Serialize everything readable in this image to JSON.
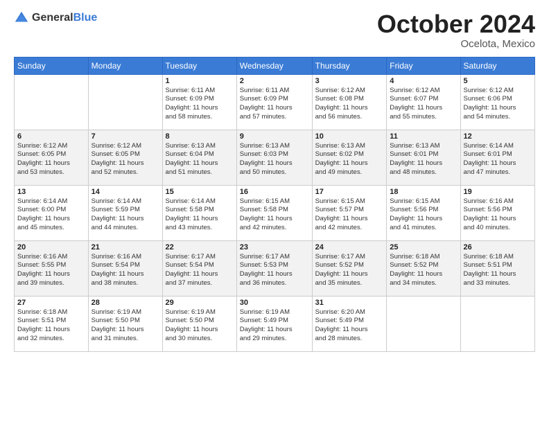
{
  "header": {
    "logo_general": "General",
    "logo_blue": "Blue",
    "title": "October 2024",
    "location": "Ocelota, Mexico"
  },
  "weekdays": [
    "Sunday",
    "Monday",
    "Tuesday",
    "Wednesday",
    "Thursday",
    "Friday",
    "Saturday"
  ],
  "weeks": [
    [
      {
        "day": "",
        "info": ""
      },
      {
        "day": "",
        "info": ""
      },
      {
        "day": "1",
        "info": "Sunrise: 6:11 AM\nSunset: 6:09 PM\nDaylight: 11 hours\nand 58 minutes."
      },
      {
        "day": "2",
        "info": "Sunrise: 6:11 AM\nSunset: 6:09 PM\nDaylight: 11 hours\nand 57 minutes."
      },
      {
        "day": "3",
        "info": "Sunrise: 6:12 AM\nSunset: 6:08 PM\nDaylight: 11 hours\nand 56 minutes."
      },
      {
        "day": "4",
        "info": "Sunrise: 6:12 AM\nSunset: 6:07 PM\nDaylight: 11 hours\nand 55 minutes."
      },
      {
        "day": "5",
        "info": "Sunrise: 6:12 AM\nSunset: 6:06 PM\nDaylight: 11 hours\nand 54 minutes."
      }
    ],
    [
      {
        "day": "6",
        "info": "Sunrise: 6:12 AM\nSunset: 6:05 PM\nDaylight: 11 hours\nand 53 minutes."
      },
      {
        "day": "7",
        "info": "Sunrise: 6:12 AM\nSunset: 6:05 PM\nDaylight: 11 hours\nand 52 minutes."
      },
      {
        "day": "8",
        "info": "Sunrise: 6:13 AM\nSunset: 6:04 PM\nDaylight: 11 hours\nand 51 minutes."
      },
      {
        "day": "9",
        "info": "Sunrise: 6:13 AM\nSunset: 6:03 PM\nDaylight: 11 hours\nand 50 minutes."
      },
      {
        "day": "10",
        "info": "Sunrise: 6:13 AM\nSunset: 6:02 PM\nDaylight: 11 hours\nand 49 minutes."
      },
      {
        "day": "11",
        "info": "Sunrise: 6:13 AM\nSunset: 6:01 PM\nDaylight: 11 hours\nand 48 minutes."
      },
      {
        "day": "12",
        "info": "Sunrise: 6:14 AM\nSunset: 6:01 PM\nDaylight: 11 hours\nand 47 minutes."
      }
    ],
    [
      {
        "day": "13",
        "info": "Sunrise: 6:14 AM\nSunset: 6:00 PM\nDaylight: 11 hours\nand 45 minutes."
      },
      {
        "day": "14",
        "info": "Sunrise: 6:14 AM\nSunset: 5:59 PM\nDaylight: 11 hours\nand 44 minutes."
      },
      {
        "day": "15",
        "info": "Sunrise: 6:14 AM\nSunset: 5:58 PM\nDaylight: 11 hours\nand 43 minutes."
      },
      {
        "day": "16",
        "info": "Sunrise: 6:15 AM\nSunset: 5:58 PM\nDaylight: 11 hours\nand 42 minutes."
      },
      {
        "day": "17",
        "info": "Sunrise: 6:15 AM\nSunset: 5:57 PM\nDaylight: 11 hours\nand 42 minutes."
      },
      {
        "day": "18",
        "info": "Sunrise: 6:15 AM\nSunset: 5:56 PM\nDaylight: 11 hours\nand 41 minutes."
      },
      {
        "day": "19",
        "info": "Sunrise: 6:16 AM\nSunset: 5:56 PM\nDaylight: 11 hours\nand 40 minutes."
      }
    ],
    [
      {
        "day": "20",
        "info": "Sunrise: 6:16 AM\nSunset: 5:55 PM\nDaylight: 11 hours\nand 39 minutes."
      },
      {
        "day": "21",
        "info": "Sunrise: 6:16 AM\nSunset: 5:54 PM\nDaylight: 11 hours\nand 38 minutes."
      },
      {
        "day": "22",
        "info": "Sunrise: 6:17 AM\nSunset: 5:54 PM\nDaylight: 11 hours\nand 37 minutes."
      },
      {
        "day": "23",
        "info": "Sunrise: 6:17 AM\nSunset: 5:53 PM\nDaylight: 11 hours\nand 36 minutes."
      },
      {
        "day": "24",
        "info": "Sunrise: 6:17 AM\nSunset: 5:52 PM\nDaylight: 11 hours\nand 35 minutes."
      },
      {
        "day": "25",
        "info": "Sunrise: 6:18 AM\nSunset: 5:52 PM\nDaylight: 11 hours\nand 34 minutes."
      },
      {
        "day": "26",
        "info": "Sunrise: 6:18 AM\nSunset: 5:51 PM\nDaylight: 11 hours\nand 33 minutes."
      }
    ],
    [
      {
        "day": "27",
        "info": "Sunrise: 6:18 AM\nSunset: 5:51 PM\nDaylight: 11 hours\nand 32 minutes."
      },
      {
        "day": "28",
        "info": "Sunrise: 6:19 AM\nSunset: 5:50 PM\nDaylight: 11 hours\nand 31 minutes."
      },
      {
        "day": "29",
        "info": "Sunrise: 6:19 AM\nSunset: 5:50 PM\nDaylight: 11 hours\nand 30 minutes."
      },
      {
        "day": "30",
        "info": "Sunrise: 6:19 AM\nSunset: 5:49 PM\nDaylight: 11 hours\nand 29 minutes."
      },
      {
        "day": "31",
        "info": "Sunrise: 6:20 AM\nSunset: 5:49 PM\nDaylight: 11 hours\nand 28 minutes."
      },
      {
        "day": "",
        "info": ""
      },
      {
        "day": "",
        "info": ""
      }
    ]
  ]
}
